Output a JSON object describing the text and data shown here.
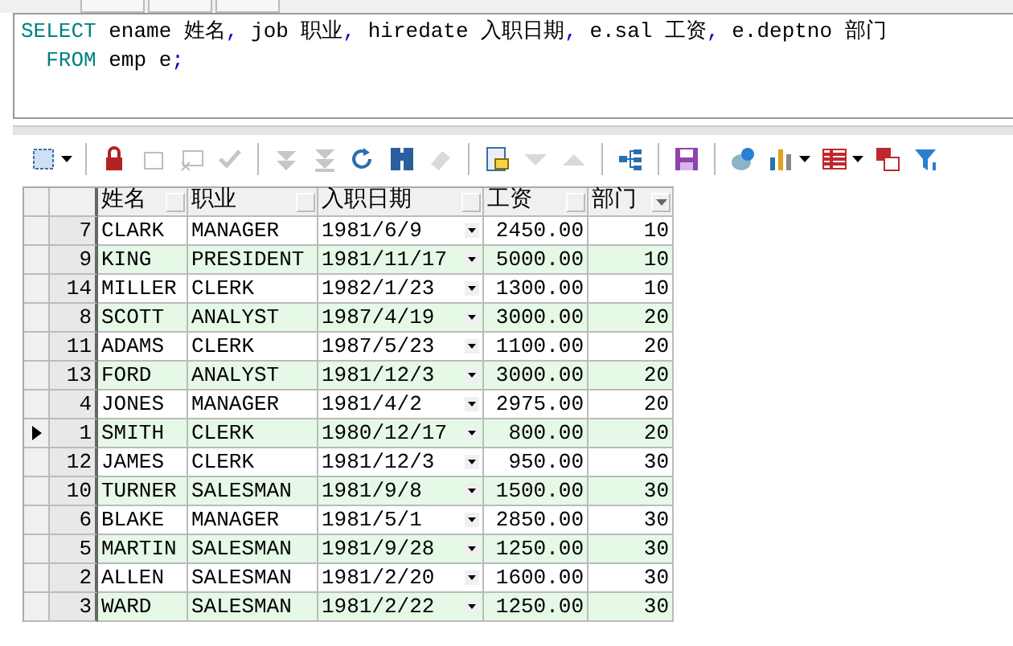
{
  "sql_editor": {
    "lines": [
      [
        {
          "kind": "keyword",
          "text": "SELECT"
        },
        {
          "kind": "text",
          "text": " ename 姓名"
        },
        {
          "kind": "punct",
          "text": ","
        },
        {
          "kind": "text",
          "text": " job 职业"
        },
        {
          "kind": "punct",
          "text": ","
        },
        {
          "kind": "text",
          "text": " hiredate 入职日期"
        },
        {
          "kind": "punct",
          "text": ","
        },
        {
          "kind": "text",
          "text": " e.sal 工资"
        },
        {
          "kind": "punct",
          "text": ","
        },
        {
          "kind": "text",
          "text": " e.deptno 部门"
        }
      ],
      [
        {
          "kind": "keyword",
          "text": "  FROM"
        },
        {
          "kind": "text",
          "text": " emp e"
        },
        {
          "kind": "punct",
          "text": ";"
        }
      ]
    ]
  },
  "toolbar": [
    {
      "disabled": false
    },
    {
      "disabled": false
    },
    {
      "disabled": true
    },
    {
      "disabled": true
    },
    {
      "disabled": true
    },
    {
      "disabled": true
    },
    {
      "disabled": true
    },
    {
      "disabled": false
    },
    {
      "disabled": false
    },
    {
      "disabled": true
    },
    {
      "disabled": false
    },
    {
      "disabled": true
    },
    {
      "disabled": true
    },
    {
      "disabled": false
    },
    {
      "disabled": false
    },
    {
      "disabled": false
    },
    {
      "disabled": false
    },
    {
      "disabled": false
    },
    {
      "disabled": false
    },
    {
      "disabled": false
    }
  ],
  "table": {
    "columns": [
      "姓名",
      "职业",
      "入职日期",
      "工资",
      "部门"
    ],
    "rows": [
      {
        "num": "7",
        "cells": [
          "CLARK",
          "MANAGER",
          "1981/6/9",
          "2450.00",
          "10"
        ],
        "selected": false
      },
      {
        "num": "9",
        "cells": [
          "KING",
          "PRESIDENT",
          "1981/11/17",
          "5000.00",
          "10"
        ],
        "selected": false
      },
      {
        "num": "14",
        "cells": [
          "MILLER",
          "CLERK",
          "1982/1/23",
          "1300.00",
          "10"
        ],
        "selected": false
      },
      {
        "num": "8",
        "cells": [
          "SCOTT",
          "ANALYST",
          "1987/4/19",
          "3000.00",
          "20"
        ],
        "selected": false
      },
      {
        "num": "11",
        "cells": [
          "ADAMS",
          "CLERK",
          "1987/5/23",
          "1100.00",
          "20"
        ],
        "selected": false
      },
      {
        "num": "13",
        "cells": [
          "FORD",
          "ANALYST",
          "1981/12/3",
          "3000.00",
          "20"
        ],
        "selected": false
      },
      {
        "num": "4",
        "cells": [
          "JONES",
          "MANAGER",
          "1981/4/2",
          "2975.00",
          "20"
        ],
        "selected": false
      },
      {
        "num": "1",
        "cells": [
          "SMITH",
          "CLERK",
          "1980/12/17",
          "800.00",
          "20"
        ],
        "selected": true
      },
      {
        "num": "12",
        "cells": [
          "JAMES",
          "CLERK",
          "1981/12/3",
          "950.00",
          "30"
        ],
        "selected": false
      },
      {
        "num": "10",
        "cells": [
          "TURNER",
          "SALESMAN",
          "1981/9/8",
          "1500.00",
          "30"
        ],
        "selected": false
      },
      {
        "num": "6",
        "cells": [
          "BLAKE",
          "MANAGER",
          "1981/5/1",
          "2850.00",
          "30"
        ],
        "selected": false
      },
      {
        "num": "5",
        "cells": [
          "MARTIN",
          "SALESMAN",
          "1981/9/28",
          "1250.00",
          "30"
        ],
        "selected": false
      },
      {
        "num": "2",
        "cells": [
          "ALLEN",
          "SALESMAN",
          "1981/2/20",
          "1600.00",
          "30"
        ],
        "selected": false
      },
      {
        "num": "3",
        "cells": [
          "WARD",
          "SALESMAN",
          "1981/2/22",
          "1250.00",
          "30"
        ],
        "selected": false
      }
    ]
  }
}
